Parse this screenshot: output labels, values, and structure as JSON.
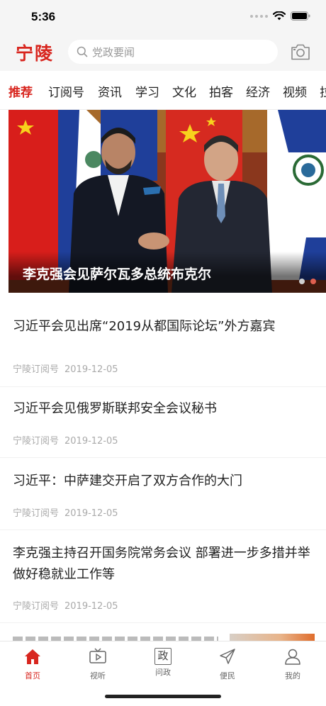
{
  "status_bar": {
    "time": "5:36"
  },
  "header": {
    "logo": "宁陵",
    "search_placeholder": "党政要闻",
    "icons": [
      "search-icon",
      "camera-icon"
    ]
  },
  "tabs": [
    {
      "label": "推荐",
      "active": true
    },
    {
      "label": "订阅号",
      "active": false
    },
    {
      "label": "资讯",
      "active": false
    },
    {
      "label": "学习",
      "active": false
    },
    {
      "label": "文化",
      "active": false
    },
    {
      "label": "拍客",
      "active": false
    },
    {
      "label": "经济",
      "active": false
    },
    {
      "label": "视频",
      "active": false
    },
    {
      "label": "拉",
      "active": false
    }
  ],
  "hero": {
    "caption": "李克强会见萨尔瓦多总统布克尔",
    "slide_count": 2,
    "active_slide": 2
  },
  "news": [
    {
      "title": "习近平会见出席“2019从都国际论坛”外方嘉宾",
      "source": "宁陵订阅号",
      "date": "2019-12-05"
    },
    {
      "title": "习近平会见俄罗斯联邦安全会议秘书",
      "source": "宁陵订阅号",
      "date": "2019-12-05"
    },
    {
      "title": "习近平：中萨建交开启了双方合作的大门",
      "source": "宁陵订阅号",
      "date": "2019-12-05"
    },
    {
      "title": "李克强主持召开国务院常务会议 部署进一步多措并举做好稳就业工作等",
      "source": "宁陵订阅号",
      "date": "2019-12-05"
    }
  ],
  "bottom_nav": [
    {
      "label": "首页",
      "icon": "home-icon",
      "active": true
    },
    {
      "label": "视听",
      "icon": "tv-icon",
      "active": false
    },
    {
      "label": "问政",
      "icon": "zheng-icon",
      "glyph": "政",
      "active": false
    },
    {
      "label": "便民",
      "icon": "send-icon",
      "active": false
    },
    {
      "label": "我的",
      "icon": "user-icon",
      "active": false
    }
  ],
  "colors": {
    "accent": "#d8261f",
    "muted": "#aaaaaa"
  }
}
